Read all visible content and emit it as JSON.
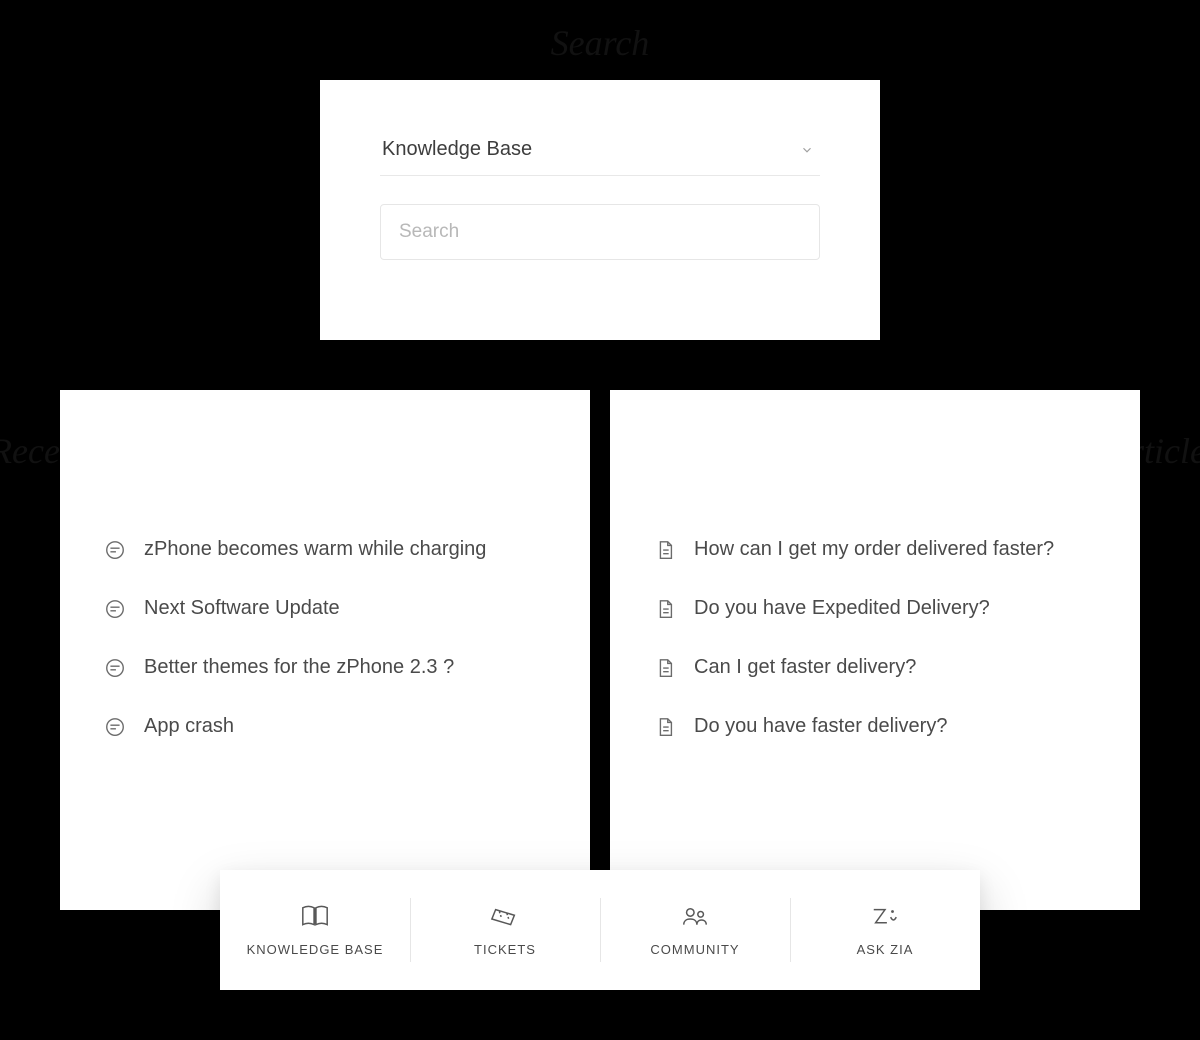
{
  "labels": {
    "search": "Search",
    "recent_topics": "Recent topics",
    "recent_articles": "Recent articles"
  },
  "search_card": {
    "dropdown_label": "Knowledge Base",
    "input_placeholder": "Search"
  },
  "recent_topics": [
    {
      "title": "zPhone becomes warm while charging"
    },
    {
      "title": "Next Software Update"
    },
    {
      "title": "Better themes for the zPhone 2.3 ?"
    },
    {
      "title": "App crash"
    }
  ],
  "recent_articles": [
    {
      "title": "How can I get my order delivered faster?"
    },
    {
      "title": "Do you have Expedited Delivery?"
    },
    {
      "title": "Can I get faster delivery?"
    },
    {
      "title": "Do you have faster delivery?"
    }
  ],
  "nav": [
    {
      "label": "KNOWLEDGE BASE"
    },
    {
      "label": "TICKETS"
    },
    {
      "label": "COMMUNITY"
    },
    {
      "label": "ASK ZIA"
    }
  ]
}
